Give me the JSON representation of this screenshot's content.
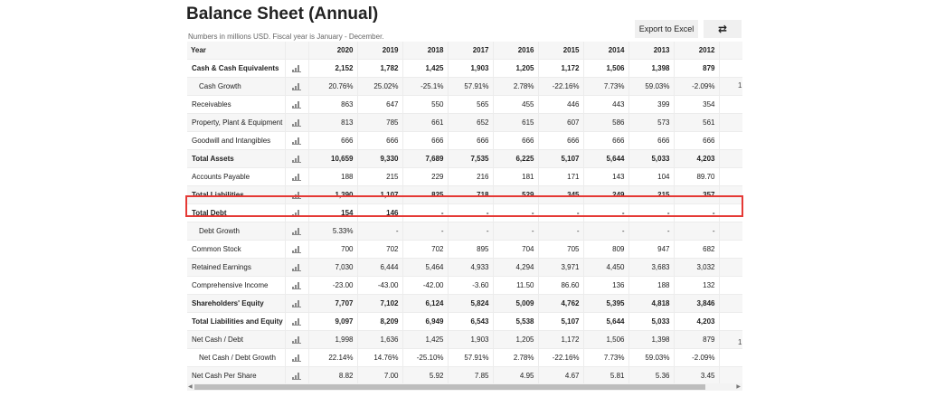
{
  "header": {
    "title": "Balance Sheet (Annual)",
    "subtitle": "Numbers in millions USD. Fiscal year is January - December.",
    "export_label": "Export to Excel",
    "swap_icon": "swap-arrows-icon",
    "swap_glyph": "⇄"
  },
  "table": {
    "header_label": "Year",
    "years": [
      "2020",
      "2019",
      "2018",
      "2017",
      "2016",
      "2015",
      "2014",
      "2013",
      "2012"
    ],
    "rows": [
      {
        "label": "Cash & Cash Equivalents",
        "bold": true,
        "sub": false,
        "values": [
          "2,152",
          "1,782",
          "1,425",
          "1,903",
          "1,205",
          "1,172",
          "1,506",
          "1,398",
          "879"
        ]
      },
      {
        "label": "Cash Growth",
        "bold": false,
        "sub": true,
        "values": [
          "20.76%",
          "25.02%",
          "-25.1%",
          "57.91%",
          "2.78%",
          "-22.16%",
          "7.73%",
          "59.03%",
          "-2.09%"
        ]
      },
      {
        "label": "Receivables",
        "bold": false,
        "sub": false,
        "values": [
          "863",
          "647",
          "550",
          "565",
          "455",
          "446",
          "443",
          "399",
          "354"
        ]
      },
      {
        "label": "Property, Plant & Equipment",
        "bold": false,
        "sub": false,
        "values": [
          "813",
          "785",
          "661",
          "652",
          "615",
          "607",
          "586",
          "573",
          "561"
        ]
      },
      {
        "label": "Goodwill and Intangibles",
        "bold": false,
        "sub": false,
        "values": [
          "666",
          "666",
          "666",
          "666",
          "666",
          "666",
          "666",
          "666",
          "666"
        ]
      },
      {
        "label": "Total Assets",
        "bold": true,
        "sub": false,
        "values": [
          "10,659",
          "9,330",
          "7,689",
          "7,535",
          "6,225",
          "5,107",
          "5,644",
          "5,033",
          "4,203"
        ]
      },
      {
        "label": "Accounts Payable",
        "bold": false,
        "sub": false,
        "values": [
          "188",
          "215",
          "229",
          "216",
          "181",
          "171",
          "143",
          "104",
          "89.70"
        ]
      },
      {
        "label": "Total Liabilities",
        "bold": true,
        "sub": false,
        "values": [
          "1,390",
          "1,107",
          "825",
          "718",
          "529",
          "345",
          "249",
          "215",
          "357"
        ]
      },
      {
        "label": "Total Debt",
        "bold": true,
        "sub": false,
        "values": [
          "154",
          "146",
          "-",
          "-",
          "-",
          "-",
          "-",
          "-",
          "-"
        ]
      },
      {
        "label": "Debt Growth",
        "bold": false,
        "sub": true,
        "values": [
          "5.33%",
          "-",
          "-",
          "-",
          "-",
          "-",
          "-",
          "-",
          "-"
        ]
      },
      {
        "label": "Common Stock",
        "bold": false,
        "sub": false,
        "values": [
          "700",
          "702",
          "702",
          "895",
          "704",
          "705",
          "809",
          "947",
          "682"
        ]
      },
      {
        "label": "Retained Earnings",
        "bold": false,
        "sub": false,
        "values": [
          "7,030",
          "6,444",
          "5,464",
          "4,933",
          "4,294",
          "3,971",
          "4,450",
          "3,683",
          "3,032"
        ]
      },
      {
        "label": "Comprehensive Income",
        "bold": false,
        "sub": false,
        "values": [
          "-23.00",
          "-43.00",
          "-42.00",
          "-3.60",
          "11.50",
          "86.60",
          "136",
          "188",
          "132"
        ]
      },
      {
        "label": "Shareholders' Equity",
        "bold": true,
        "sub": false,
        "values": [
          "7,707",
          "7,102",
          "6,124",
          "5,824",
          "5,009",
          "4,762",
          "5,395",
          "4,818",
          "3,846"
        ]
      },
      {
        "label": "Total Liabilities and Equity",
        "bold": true,
        "sub": false,
        "values": [
          "9,097",
          "8,209",
          "6,949",
          "6,543",
          "5,538",
          "5,107",
          "5,644",
          "5,033",
          "4,203"
        ]
      },
      {
        "label": "Net Cash / Debt",
        "bold": false,
        "sub": false,
        "values": [
          "1,998",
          "1,636",
          "1,425",
          "1,903",
          "1,205",
          "1,172",
          "1,506",
          "1,398",
          "879"
        ]
      },
      {
        "label": "Net Cash / Debt Growth",
        "bold": false,
        "sub": true,
        "values": [
          "22.14%",
          "14.76%",
          "-25.10%",
          "57.91%",
          "2.78%",
          "-22.16%",
          "7.73%",
          "59.03%",
          "-2.09%"
        ]
      },
      {
        "label": "Net Cash Per Share",
        "bold": false,
        "sub": false,
        "values": [
          "8.82",
          "7.00",
          "5.92",
          "7.85",
          "4.95",
          "4.67",
          "5.81",
          "5.36",
          "3.45"
        ]
      },
      {
        "label": "Book Value Per Share",
        "bold": false,
        "sub": false,
        "values": [
          "34.04",
          "30.39",
          "25.45",
          "24.04",
          "20.58",
          "18.97",
          "20.80",
          "18.47",
          "15.09"
        ]
      }
    ],
    "row_chart_icon": "bar-chart-icon",
    "overflow_marker": "1",
    "scroll_left_glyph": "◀",
    "scroll_right_glyph": "▶"
  },
  "highlight": {
    "row": "Total Debt",
    "color": "#e53935"
  },
  "colors": {
    "header_bg": "#f6f6f6",
    "button_bg": "#f0f0f0",
    "highlight_border": "#e53935"
  }
}
